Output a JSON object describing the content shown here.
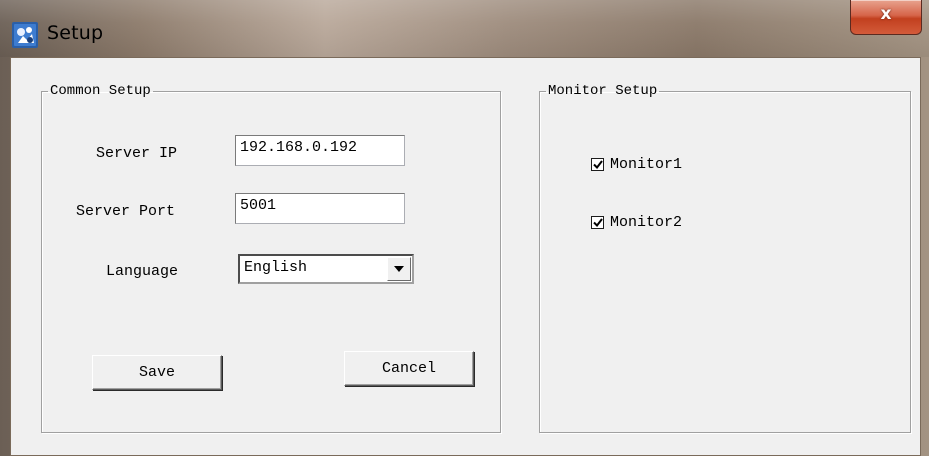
{
  "window": {
    "title": "Setup",
    "close_glyph": "x",
    "app_icon": "app-icon"
  },
  "common_setup": {
    "legend": "Common Setup",
    "server_ip": {
      "label": "Server IP",
      "value": "192.168.0.192"
    },
    "server_port": {
      "label": "Server Port",
      "value": "5001"
    },
    "language": {
      "label": "Language",
      "selected": "English"
    },
    "save_label": "Save",
    "cancel_label": "Cancel"
  },
  "monitor_setup": {
    "legend": "Monitor Setup",
    "monitors": [
      {
        "label": "Monitor1",
        "checked": true
      },
      {
        "label": "Monitor2",
        "checked": true
      }
    ]
  },
  "colors": {
    "window_background": "#f0f0f0",
    "close_button": "#c2401f",
    "group_border": "#a0a0a0"
  }
}
